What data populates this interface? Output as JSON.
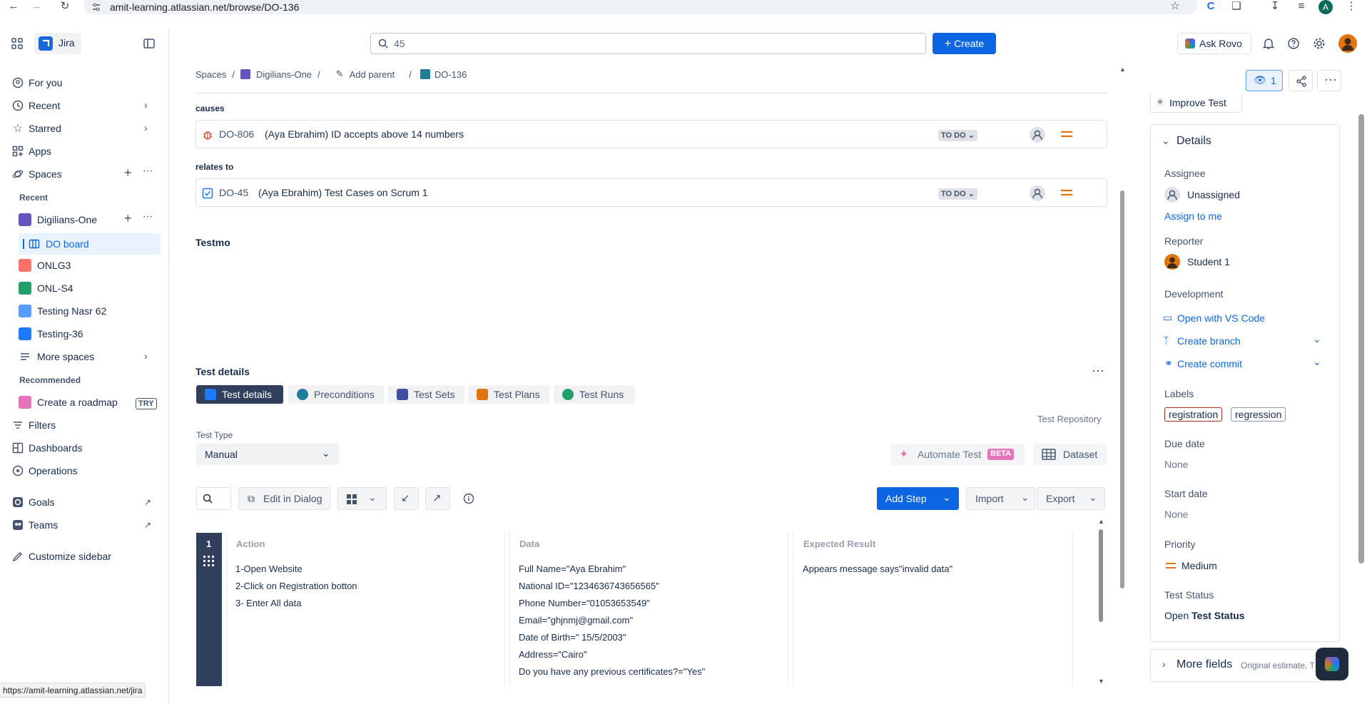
{
  "browser": {
    "url": "amit-learning.atlassian.net/browse/DO-136",
    "avatar_letter": "A",
    "status_url": "https://amit-learning.atlassian.net/jira"
  },
  "topnav": {
    "app_name": "Jira",
    "search_value": "45",
    "create_label": "Create",
    "ask_rovo_label": "Ask Rovo"
  },
  "sidebar": {
    "items": {
      "for_you": "For you",
      "recent": "Recent",
      "starred": "Starred",
      "apps": "Apps",
      "spaces": "Spaces"
    },
    "recent_header": "Recent",
    "projects": {
      "digilians": "Digilians-One",
      "do_board": "DO board",
      "onlg3": "ONLG3",
      "onl_s4": "ONL-S4",
      "testing_nasr": "Testing Nasr 62",
      "testing_36": "Testing-36",
      "more_spaces": "More spaces"
    },
    "recommended_header": "Recommended",
    "roadmap": "Create a roadmap",
    "try_badge": "TRY",
    "filters": "Filters",
    "dashboards": "Dashboards",
    "operations": "Operations",
    "goals": "Goals",
    "teams": "Teams",
    "customize": "Customize sidebar"
  },
  "breadcrumb": {
    "spaces": "Spaces",
    "project": "Digilians-One",
    "add_parent": "Add parent",
    "issue": "DO-136"
  },
  "links": {
    "causes_header": "causes",
    "relates_header": "relates to",
    "items": [
      {
        "key": "DO-806",
        "summary": "(Aya Ebrahim) ID accepts above 14 numbers",
        "status": "TO DO"
      },
      {
        "key": "DO-45",
        "summary": "(Aya Ebrahim) Test Cases on Scrum 1",
        "status": "TO DO"
      }
    ]
  },
  "testmo_title": "Testmo",
  "test_details": {
    "title": "Test details",
    "tabs": [
      "Test details",
      "Preconditions",
      "Test Sets",
      "Test Plans",
      "Test Runs"
    ],
    "repository": "Test Repository",
    "test_type_label": "Test Type",
    "test_type_value": "Manual",
    "automate_label": "Automate Test",
    "beta_badge": "BETA",
    "dataset_label": "Dataset",
    "edit_dialog": "Edit in Dialog",
    "add_step": "Add Step",
    "import": "Import",
    "export": "Export",
    "columns": [
      "Action",
      "Data",
      "Expected Result"
    ],
    "step_number": "1",
    "action_lines": [
      "1-Open Website",
      "2-Click on Registration botton",
      "3- Enter All data"
    ],
    "data_lines": [
      "Full Name=\"Aya Ebrahim\"",
      "National ID=\"1234636743656565\"",
      "Phone Number=\"01053653549\"",
      "Email=\"ghjnmj@gmail.com\"",
      "Date of Birth=\" 15/5/2003\"",
      "Address=\"Cairo\"",
      "Do you have any previous certificates?=\"Yes\""
    ],
    "expected": "Appears message says\"invalid data\""
  },
  "right_panel": {
    "watch_count": "1",
    "improve_test": "Improve Test",
    "details_title": "Details",
    "assignee_label": "Assignee",
    "assignee_value": "Unassigned",
    "assign_to_me": "Assign to me",
    "reporter_label": "Reporter",
    "reporter_value": "Student 1",
    "development_label": "Development",
    "open_vscode": "Open with VS Code",
    "create_branch": "Create branch",
    "create_commit": "Create commit",
    "labels_label": "Labels",
    "labels": [
      "registration",
      "regression"
    ],
    "due_date_label": "Due date",
    "due_date_value": "None",
    "start_date_label": "Start date",
    "start_date_value": "None",
    "priority_label": "Priority",
    "priority_value": "Medium",
    "test_status_label": "Test Status",
    "test_status_open": "Open",
    "test_status_bold": "Test Status",
    "more_fields": "More fields",
    "more_fields_sub": "Original estimate, T"
  },
  "colors": {
    "brand_blue": "#0c66e4",
    "priority_orange": "#e2740d",
    "bug_red": "#e34935",
    "sidebar_selected_bg": "#e9f2ff",
    "step_bar": "#2f3f5c"
  }
}
